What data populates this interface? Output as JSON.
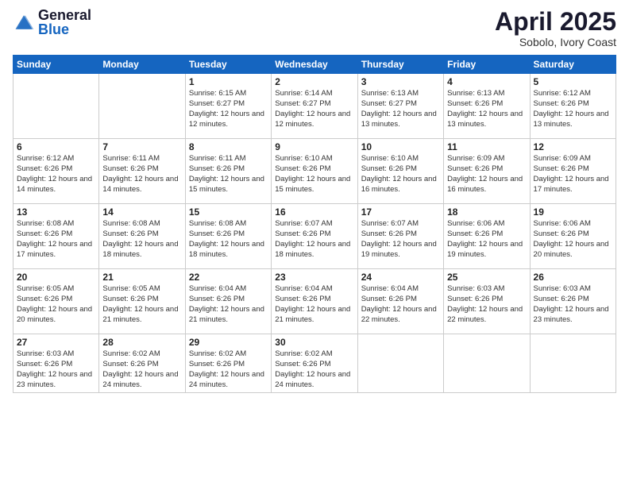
{
  "logo": {
    "general": "General",
    "blue": "Blue"
  },
  "title": {
    "month": "April 2025",
    "location": "Sobolo, Ivory Coast"
  },
  "weekdays": [
    "Sunday",
    "Monday",
    "Tuesday",
    "Wednesday",
    "Thursday",
    "Friday",
    "Saturday"
  ],
  "weeks": [
    [
      {
        "day": "",
        "info": ""
      },
      {
        "day": "",
        "info": ""
      },
      {
        "day": "1",
        "info": "Sunrise: 6:15 AM\nSunset: 6:27 PM\nDaylight: 12 hours and 12 minutes."
      },
      {
        "day": "2",
        "info": "Sunrise: 6:14 AM\nSunset: 6:27 PM\nDaylight: 12 hours and 12 minutes."
      },
      {
        "day": "3",
        "info": "Sunrise: 6:13 AM\nSunset: 6:27 PM\nDaylight: 12 hours and 13 minutes."
      },
      {
        "day": "4",
        "info": "Sunrise: 6:13 AM\nSunset: 6:26 PM\nDaylight: 12 hours and 13 minutes."
      },
      {
        "day": "5",
        "info": "Sunrise: 6:12 AM\nSunset: 6:26 PM\nDaylight: 12 hours and 13 minutes."
      }
    ],
    [
      {
        "day": "6",
        "info": "Sunrise: 6:12 AM\nSunset: 6:26 PM\nDaylight: 12 hours and 14 minutes."
      },
      {
        "day": "7",
        "info": "Sunrise: 6:11 AM\nSunset: 6:26 PM\nDaylight: 12 hours and 14 minutes."
      },
      {
        "day": "8",
        "info": "Sunrise: 6:11 AM\nSunset: 6:26 PM\nDaylight: 12 hours and 15 minutes."
      },
      {
        "day": "9",
        "info": "Sunrise: 6:10 AM\nSunset: 6:26 PM\nDaylight: 12 hours and 15 minutes."
      },
      {
        "day": "10",
        "info": "Sunrise: 6:10 AM\nSunset: 6:26 PM\nDaylight: 12 hours and 16 minutes."
      },
      {
        "day": "11",
        "info": "Sunrise: 6:09 AM\nSunset: 6:26 PM\nDaylight: 12 hours and 16 minutes."
      },
      {
        "day": "12",
        "info": "Sunrise: 6:09 AM\nSunset: 6:26 PM\nDaylight: 12 hours and 17 minutes."
      }
    ],
    [
      {
        "day": "13",
        "info": "Sunrise: 6:08 AM\nSunset: 6:26 PM\nDaylight: 12 hours and 17 minutes."
      },
      {
        "day": "14",
        "info": "Sunrise: 6:08 AM\nSunset: 6:26 PM\nDaylight: 12 hours and 18 minutes."
      },
      {
        "day": "15",
        "info": "Sunrise: 6:08 AM\nSunset: 6:26 PM\nDaylight: 12 hours and 18 minutes."
      },
      {
        "day": "16",
        "info": "Sunrise: 6:07 AM\nSunset: 6:26 PM\nDaylight: 12 hours and 18 minutes."
      },
      {
        "day": "17",
        "info": "Sunrise: 6:07 AM\nSunset: 6:26 PM\nDaylight: 12 hours and 19 minutes."
      },
      {
        "day": "18",
        "info": "Sunrise: 6:06 AM\nSunset: 6:26 PM\nDaylight: 12 hours and 19 minutes."
      },
      {
        "day": "19",
        "info": "Sunrise: 6:06 AM\nSunset: 6:26 PM\nDaylight: 12 hours and 20 minutes."
      }
    ],
    [
      {
        "day": "20",
        "info": "Sunrise: 6:05 AM\nSunset: 6:26 PM\nDaylight: 12 hours and 20 minutes."
      },
      {
        "day": "21",
        "info": "Sunrise: 6:05 AM\nSunset: 6:26 PM\nDaylight: 12 hours and 21 minutes."
      },
      {
        "day": "22",
        "info": "Sunrise: 6:04 AM\nSunset: 6:26 PM\nDaylight: 12 hours and 21 minutes."
      },
      {
        "day": "23",
        "info": "Sunrise: 6:04 AM\nSunset: 6:26 PM\nDaylight: 12 hours and 21 minutes."
      },
      {
        "day": "24",
        "info": "Sunrise: 6:04 AM\nSunset: 6:26 PM\nDaylight: 12 hours and 22 minutes."
      },
      {
        "day": "25",
        "info": "Sunrise: 6:03 AM\nSunset: 6:26 PM\nDaylight: 12 hours and 22 minutes."
      },
      {
        "day": "26",
        "info": "Sunrise: 6:03 AM\nSunset: 6:26 PM\nDaylight: 12 hours and 23 minutes."
      }
    ],
    [
      {
        "day": "27",
        "info": "Sunrise: 6:03 AM\nSunset: 6:26 PM\nDaylight: 12 hours and 23 minutes."
      },
      {
        "day": "28",
        "info": "Sunrise: 6:02 AM\nSunset: 6:26 PM\nDaylight: 12 hours and 24 minutes."
      },
      {
        "day": "29",
        "info": "Sunrise: 6:02 AM\nSunset: 6:26 PM\nDaylight: 12 hours and 24 minutes."
      },
      {
        "day": "30",
        "info": "Sunrise: 6:02 AM\nSunset: 6:26 PM\nDaylight: 12 hours and 24 minutes."
      },
      {
        "day": "",
        "info": ""
      },
      {
        "day": "",
        "info": ""
      },
      {
        "day": "",
        "info": ""
      }
    ]
  ]
}
